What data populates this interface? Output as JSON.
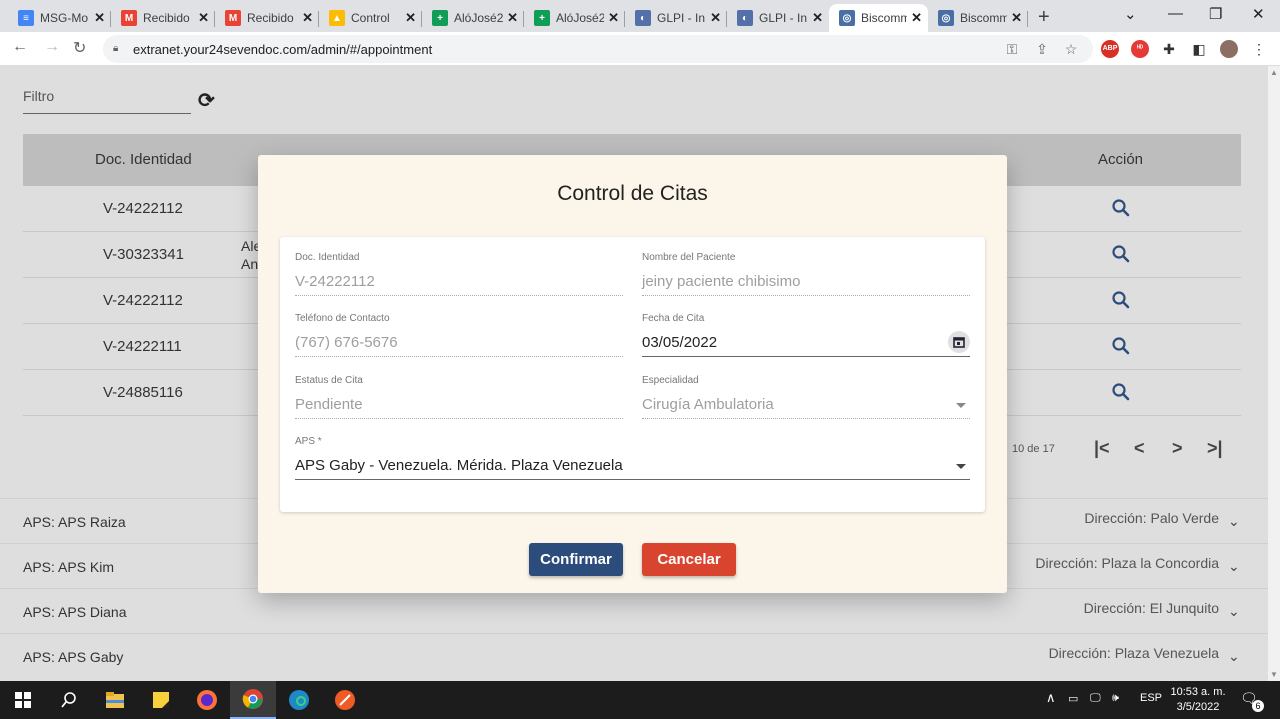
{
  "browser": {
    "tabs": [
      {
        "title": "MSG-Mo",
        "favicon": "docs-icon",
        "color": "#4285f4",
        "glyph": "≡"
      },
      {
        "title": "Recibido",
        "favicon": "gmail-icon",
        "color": "#ea4335",
        "glyph": "M"
      },
      {
        "title": "Recibido",
        "favicon": "gmail-icon",
        "color": "#ea4335",
        "glyph": "M"
      },
      {
        "title": "Control",
        "favicon": "drive-icon",
        "color": "#fbbc04",
        "glyph": "▲"
      },
      {
        "title": "AlóJosé2",
        "favicon": "sheets-icon",
        "color": "#0f9d58",
        "glyph": "+"
      },
      {
        "title": "AlóJosé2",
        "favicon": "sheets-icon",
        "color": "#0f9d58",
        "glyph": "+"
      },
      {
        "title": "GLPI - In",
        "favicon": "glpi-icon",
        "color": "#5470a8",
        "glyph": "◐"
      },
      {
        "title": "GLPI - In",
        "favicon": "glpi-icon",
        "color": "#5470a8",
        "glyph": "◐"
      },
      {
        "title": "Biscomm",
        "favicon": "biscomm-icon",
        "color": "#4a6fa5",
        "glyph": "◎"
      },
      {
        "title": "Biscomm",
        "favicon": "biscomm-icon",
        "color": "#4a6fa5",
        "glyph": "◎"
      }
    ],
    "url": "extranet.your24sevendoc.com/admin/#/appointment"
  },
  "page": {
    "filter_label": "Filtro",
    "columns": [
      "Doc. Identidad",
      "Acción"
    ],
    "rows": [
      {
        "doc": "V-24222112",
        "partial": ""
      },
      {
        "doc": "V-30323341",
        "partial": "Ale\nAn"
      },
      {
        "doc": "V-24222112",
        "partial": ""
      },
      {
        "doc": "V-24222111",
        "partial": ""
      },
      {
        "doc": "V-24885116",
        "partial": ""
      }
    ],
    "pager_text": "10 de 17",
    "aps_list": [
      {
        "name": "APS: APS Raiza",
        "dir": "Dirección: Palo Verde"
      },
      {
        "name": "APS: APS Kim",
        "dir": "Dirección: Plaza la Concordia"
      },
      {
        "name": "APS: APS Diana",
        "dir": "Dirección: El Junquito"
      },
      {
        "name": "APS: APS Gaby",
        "dir": "Dirección: Plaza Venezuela"
      }
    ]
  },
  "modal": {
    "title": "Control de Citas",
    "fields": {
      "doc": {
        "label": "Doc. Identidad",
        "value": "V-24222112"
      },
      "nombre": {
        "label": "Nombre del Paciente",
        "value": "jeiny paciente chibisimo"
      },
      "telefono": {
        "label": "Teléfono de Contacto",
        "value": "(767) 676-5676"
      },
      "fecha": {
        "label": "Fecha de Cita",
        "value": "03/05/2022"
      },
      "estatus": {
        "label": "Estatus de Cita",
        "value": "Pendiente"
      },
      "especialidad": {
        "label": "Especialidad",
        "value": "Cirugía Ambulatoria"
      },
      "aps": {
        "label": "APS *",
        "value": "APS Gaby - Venezuela. Mérida. Plaza Venezuela"
      }
    },
    "confirm_label": "Confirmar",
    "cancel_label": "Cancelar"
  },
  "taskbar": {
    "lang": "ESP",
    "time": "10:53 a. m.",
    "date": "3/5/2022",
    "notifications": "6"
  },
  "colors": {
    "confirm": "#2c4c7c",
    "cancel": "#d9442e",
    "modal_bg": "#fcf5ea"
  }
}
